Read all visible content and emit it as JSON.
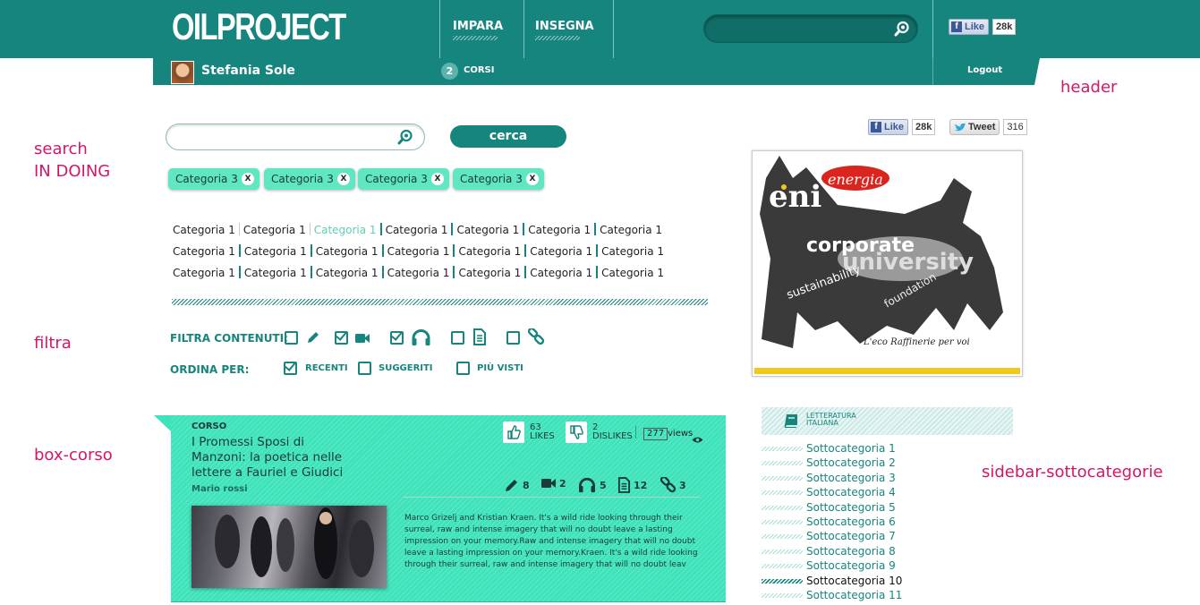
{
  "header": {
    "logo": "OILPROJECT",
    "nav": [
      "IMPARA",
      "INSEGNA"
    ],
    "search_placeholder": "",
    "fb_like": "Like",
    "fb_count": "28k",
    "user": "Stefania Sole",
    "corsi_count": "2",
    "corsi_label": "CORSI",
    "logout": "Logout"
  },
  "annotations": {
    "header": "header",
    "search_1": "search",
    "search_2": "IN DOING",
    "filtra": "filtra",
    "box_corso": "box-corso",
    "sidebar": "sidebar-sottocategorie"
  },
  "search": {
    "placeholder": "",
    "button": "cerca",
    "chips": [
      "Categoria 3",
      "Categoria 3",
      "Categoria 3",
      "Categoria 3"
    ],
    "chip_close": "X",
    "categories": [
      [
        "Categoria 1",
        "Categoria 1",
        "Categoria 1",
        "Categoria 1",
        "Categoria 1",
        "Categoria 1",
        "Categoria 1"
      ],
      [
        "Categoria 1",
        "Categoria 1",
        "Categoria 1",
        "Categoria 1",
        "Categoria 1",
        "Categoria 1",
        "Categoria 1"
      ],
      [
        "Categoria 1",
        "Categoria 1",
        "Categoria 1",
        "Categoria 1",
        "Categoria 1",
        "Categoria 1",
        "Categoria 1"
      ]
    ],
    "active_category": "Categoria 1"
  },
  "filtra": {
    "label": "FILTRA CONTENUTI:",
    "types": [
      {
        "icon": "pencil-icon",
        "checked": false
      },
      {
        "icon": "video-camera-icon",
        "checked": true
      },
      {
        "icon": "headphones-icon",
        "checked": true
      },
      {
        "icon": "document-icon",
        "checked": false
      },
      {
        "icon": "link-icon",
        "checked": false
      }
    ],
    "order_label": "ORDINA PER:",
    "order_options": [
      {
        "label": "RECENTI",
        "checked": true
      },
      {
        "label": "SUGGERITI",
        "checked": false
      },
      {
        "label": "PIÙ VISTI",
        "checked": false
      }
    ]
  },
  "box_corso": {
    "kicker": "CORSO",
    "title": "I Promessi Sposi di Manzoni: la poetica nelle lettere a Fauriel e Giudici",
    "author": "Mario rossi",
    "likes": "63",
    "likes_label": "LIKES",
    "dislikes": "2",
    "dislikes_label": "DISLIKES",
    "views": "277",
    "views_label": "views",
    "counts": {
      "pencil": "8",
      "video": "2",
      "audio": "5",
      "document": "12",
      "link": "3"
    },
    "description": "Marco Grizelj and Kristian Kraen. It's a wild ride looking through their surreal, raw and intense imagery that will no doubt leave a lasting impression on your memory.Raw and intense imagery that will no doubt leave a lasting impression on your memory.Kraen. It's a wild ride looking through their surreal, raw and intense imagery that will no doubt leav"
  },
  "right": {
    "fb_like": "Like",
    "fb_count": "28k",
    "tweet": "Tweet",
    "tweet_count": "316",
    "promo_caption": "L'eco Raffinerie per voi",
    "promo_words": [
      "eni",
      "energia",
      "corporate",
      "university",
      "sustainability",
      "foundation"
    ],
    "sidebar_title_1": "LETTERATURA",
    "sidebar_title_2": "ITALIANA",
    "subcategories": [
      "Sottocategoria 1",
      "Sottocategoria 2",
      "Sottocategoria 3",
      "Sottocategoria 4",
      "Sottocategoria 5",
      "Sottocategoria 6",
      "Sottocategoria 7",
      "Sottocategoria 8",
      "Sottocategoria 9",
      "Sottocategoria 10",
      "Sottocategoria 11"
    ],
    "active_subcategory": "Sottocategoria 10"
  },
  "colors": {
    "brand": "#16857d",
    "accent": "#3ee3bb",
    "chip": "#5fe7c2",
    "annotation": "#d4166a"
  }
}
